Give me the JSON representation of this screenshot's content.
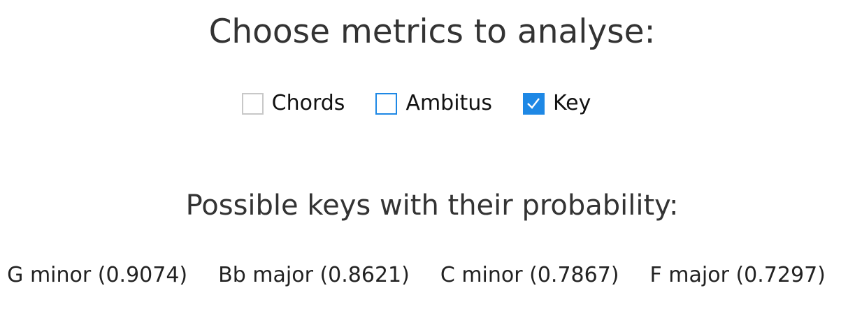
{
  "header": {
    "title": "Choose metrics to analyse:"
  },
  "metrics": [
    {
      "label": "Chords",
      "checked": false,
      "focused": false
    },
    {
      "label": "Ambitus",
      "checked": false,
      "focused": true
    },
    {
      "label": "Key",
      "checked": true,
      "focused": false
    }
  ],
  "keys_section": {
    "title": "Possible keys with their probability:",
    "items": [
      "G minor (0.9074)",
      "Bb major (0.8621)",
      "C minor (0.7867)",
      "F major (0.7297)"
    ]
  },
  "colors": {
    "accent": "#1e88e5",
    "checkbox_border": "#c8c8c8",
    "text": "#333333"
  }
}
